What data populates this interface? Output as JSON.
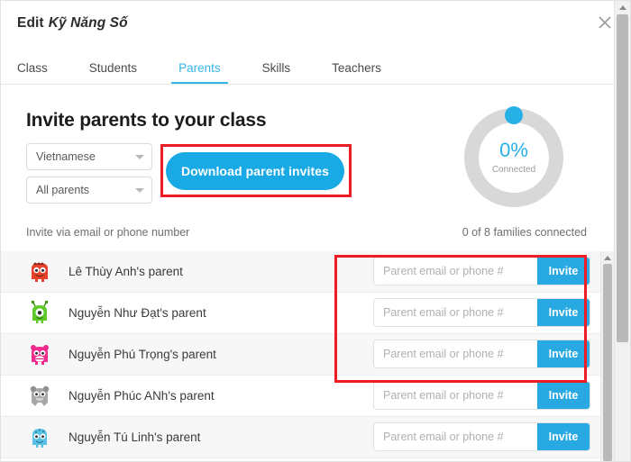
{
  "window": {
    "title_prefix": "Edit",
    "title_class": "Kỹ Năng Số",
    "close_label": "×"
  },
  "tabs": [
    {
      "label": "Class",
      "active": false
    },
    {
      "label": "Students",
      "active": false
    },
    {
      "label": "Parents",
      "active": true
    },
    {
      "label": "Skills",
      "active": false
    },
    {
      "label": "Teachers",
      "active": false
    }
  ],
  "main": {
    "heading": "Invite parents to your class",
    "language_select": {
      "value": "Vietnamese"
    },
    "scope_select": {
      "value": "All parents"
    },
    "download_button": "Download parent invites",
    "progress": {
      "percent_label": "0%",
      "percent_value": 0,
      "caption": "Connected",
      "accent_color": "#27b0e6",
      "track_color": "#d8d8d8"
    },
    "list_header": {
      "left": "Invite via email or phone number",
      "right": "0 of 8 families connected"
    },
    "invite_placeholder": "Parent email or phone #",
    "invite_button": "Invite",
    "rows": [
      {
        "name": "Lê Thùy Anh's parent",
        "avatar": "monster-red-avatar",
        "avatar_color": "#e8412c"
      },
      {
        "name": "Nguyễn Như Đạt's parent",
        "avatar": "monster-green-avatar",
        "avatar_color": "#5ec82b"
      },
      {
        "name": "Nguyễn Phú Trọng's parent",
        "avatar": "monster-pink-avatar",
        "avatar_color": "#ef2b8e"
      },
      {
        "name": "Nguyễn Phúc ANh's parent",
        "avatar": "monster-gray-avatar",
        "avatar_color": "#9b9b9b"
      },
      {
        "name": "Nguyễn Tú Linh's parent",
        "avatar": "monster-blue-avatar",
        "avatar_color": "#59c3e6"
      }
    ]
  },
  "annotations": {
    "highlight_color": "#ee1c25",
    "boxes": [
      {
        "name": "download-parent-invites-highlight"
      },
      {
        "name": "invite-fields-highlight"
      }
    ]
  }
}
